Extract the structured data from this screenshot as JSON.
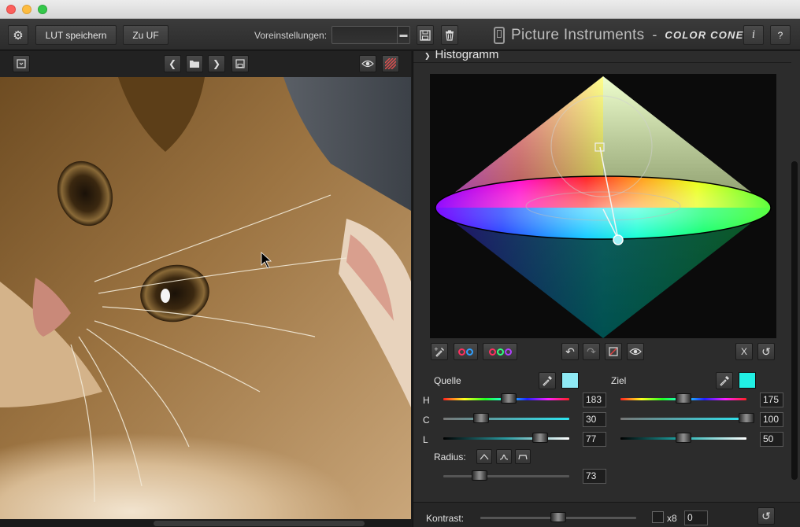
{
  "toolbar": {
    "save_lut_label": "LUT speichern",
    "to_uf_label": "Zu UF",
    "presets_label": "Voreinstellungen:",
    "preset_value": "",
    "brand_name": "Picture Instruments",
    "brand_separator": "-",
    "product_name": "COLOR CONE",
    "info_label": "i",
    "help_label": "?"
  },
  "image_toolbar": {
    "prev_glyph": "❮",
    "next_glyph": "❯"
  },
  "histogram": {
    "header": "Histogramm",
    "chevron": "❯"
  },
  "cone_tools": {
    "close_label": "X"
  },
  "source": {
    "label": "Quelle",
    "swatch_color": "#8ee9f4",
    "h_label": "H",
    "h_value": "183",
    "h_fraction": 0.52,
    "c_label": "C",
    "c_value": "30",
    "c_fraction": 0.3,
    "l_label": "L",
    "l_value": "77",
    "l_fraction": 0.77,
    "radius_label": "Radius:",
    "radius_value": "73",
    "radius_fraction": 0.29
  },
  "target": {
    "label": "Ziel",
    "swatch_color": "#21f0e4",
    "h_value": "175",
    "h_fraction": 0.5,
    "c_value": "100",
    "c_fraction": 1.0,
    "l_value": "50",
    "l_fraction": 0.5
  },
  "bottom": {
    "contrast_label": "Kontrast:",
    "contrast_fraction": 0.5,
    "x8_label": "x8",
    "contrast_value": "0"
  },
  "colors": {
    "accent": "#8ee9f4",
    "panel": "#2c2c2c"
  }
}
